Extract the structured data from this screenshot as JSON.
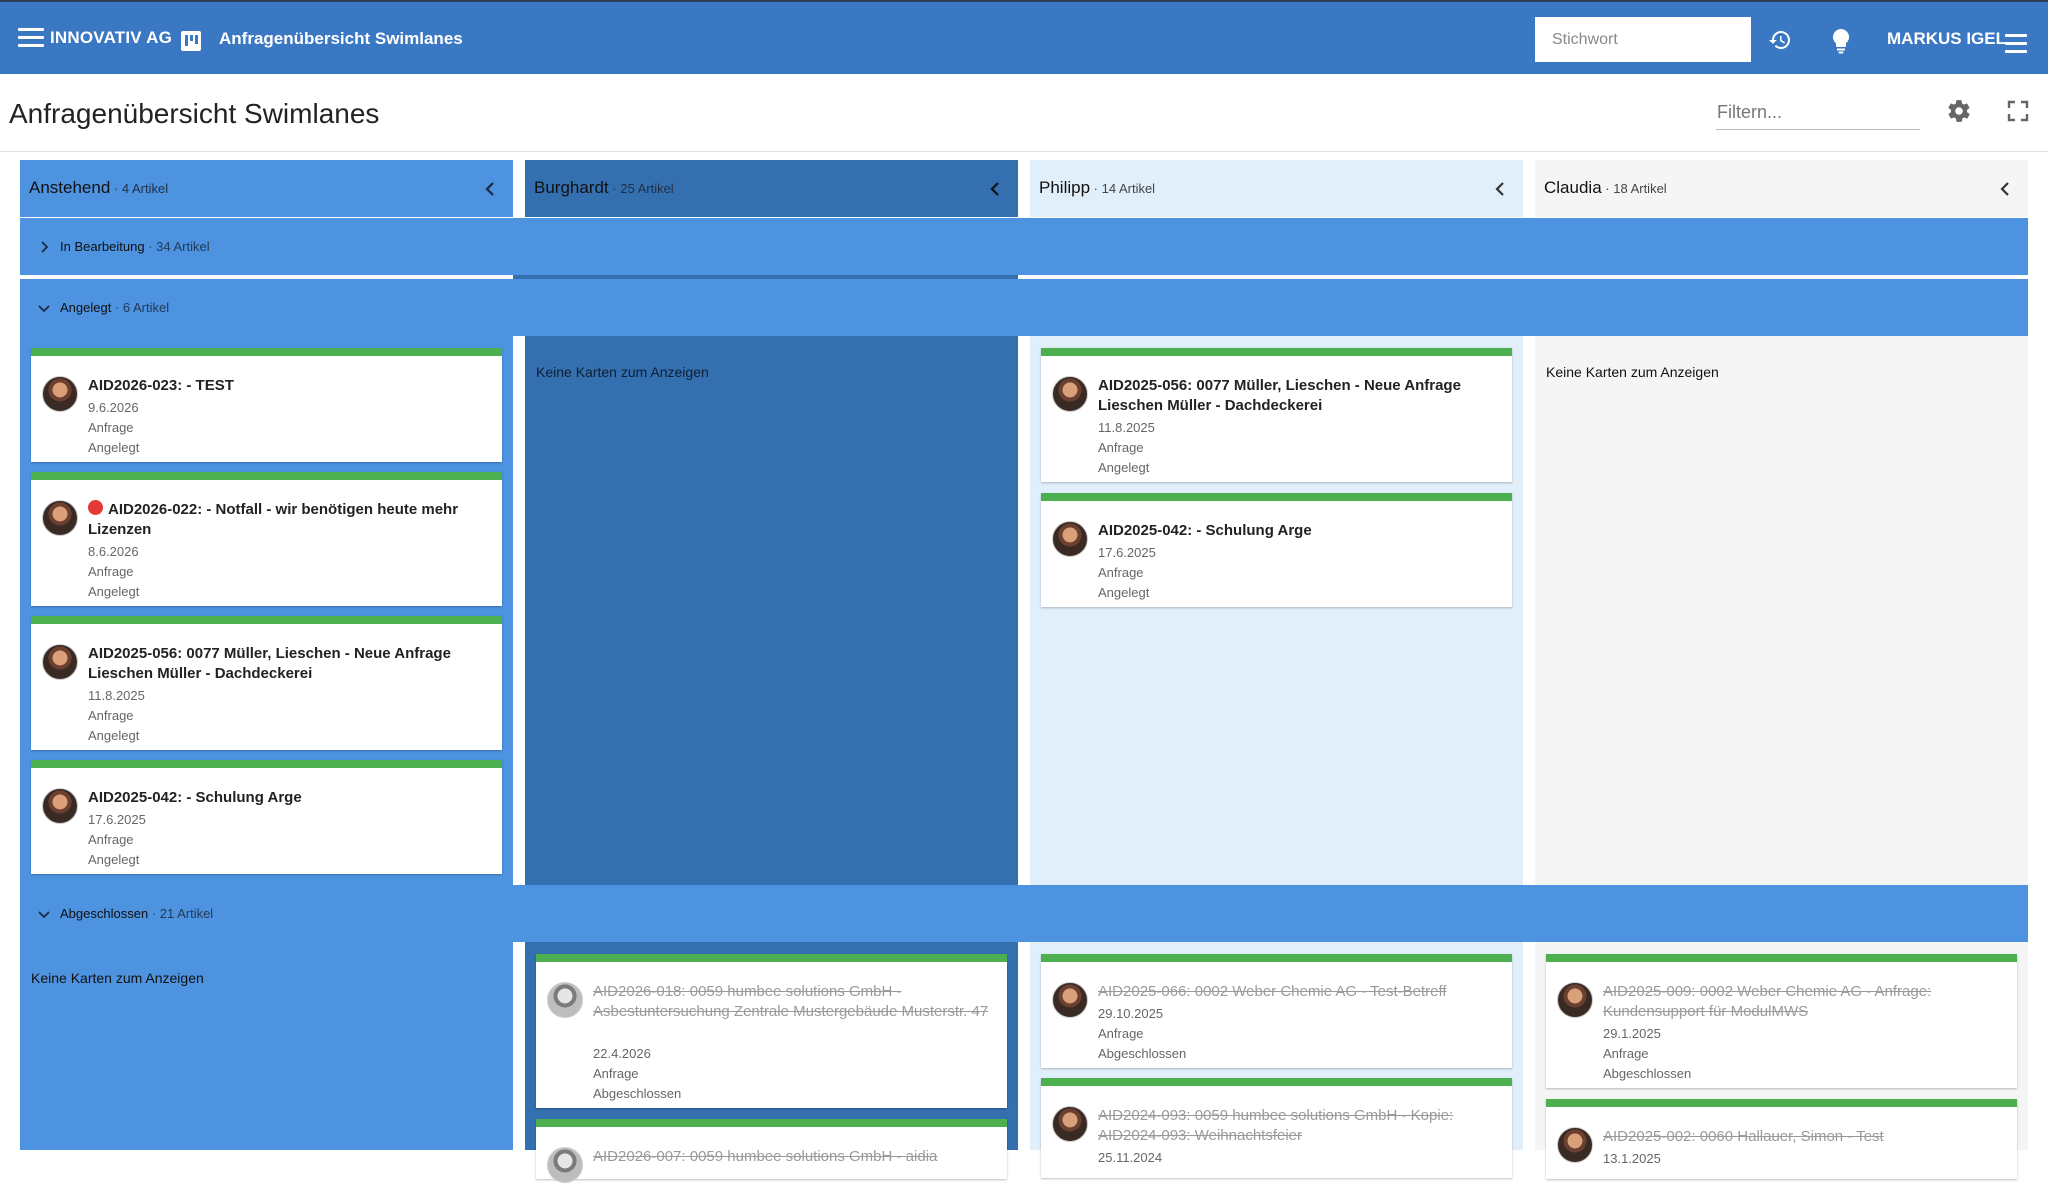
{
  "header": {
    "company": "INNOVATIV AG",
    "page_name": "Anfragenübersicht Swimlanes",
    "search_placeholder": "Stichwort",
    "user": "MARKUS IGEL"
  },
  "toolbar": {
    "title": "Anfragenübersicht Swimlanes",
    "filter_placeholder": "Filtern..."
  },
  "columns": [
    {
      "name": "Anstehend",
      "count": " · 4 Artikel"
    },
    {
      "name": "Burghardt",
      "count": " · 25 Artikel"
    },
    {
      "name": "Philipp",
      "count": " · 14 Artikel"
    },
    {
      "name": "Claudia",
      "count": " · 18 Artikel"
    }
  ],
  "groups": [
    {
      "label": "In Bearbeitung",
      "count": " · 34 Artikel",
      "expanded": false
    },
    {
      "label": "Angelegt",
      "count": " · 6 Artikel",
      "expanded": true
    },
    {
      "label": "Abgeschlossen",
      "count": " · 21 Artikel",
      "expanded": true
    }
  ],
  "empty_text": "Keine Karten zum Anzeigen",
  "angelegt": {
    "anstehend": [
      {
        "title": "AID2026-023: - TEST",
        "date": "9.6.2026",
        "type": "Anfrage",
        "status": "Angelegt"
      },
      {
        "title": "AID2026-022: - Notfall - wir benötigen heute mehr Lizenzen",
        "date": "8.6.2026",
        "type": "Anfrage",
        "status": "Angelegt"
      },
      {
        "title": "AID2025-056: 0077 Müller, Lieschen - Neue Anfrage Lieschen Müller - Dachdeckerei",
        "date": "11.8.2025",
        "type": "Anfrage",
        "status": "Angelegt"
      },
      {
        "title": "AID2025-042: - Schulung Arge",
        "date": "17.6.2025",
        "type": "Anfrage",
        "status": "Angelegt"
      }
    ],
    "philipp": [
      {
        "title": "AID2025-056: 0077 Müller, Lieschen - Neue Anfrage Lieschen Müller - Dachdeckerei",
        "date": "11.8.2025",
        "type": "Anfrage",
        "status": "Angelegt"
      },
      {
        "title": "AID2025-042: - Schulung Arge",
        "date": "17.6.2025",
        "type": "Anfrage",
        "status": "Angelegt"
      }
    ]
  },
  "abgeschlossen": {
    "burghardt": [
      {
        "title": "AID2026-018: 0059 humbee solutions GmbH - Asbestuntersuchung Zentrale Mustergebäude Musterstr. 47",
        "date": "22.4.2026",
        "type": "Anfrage",
        "status": "Abgeschlossen"
      },
      {
        "title": "AID2026-007: 0059 humbee solutions GmbH - aidia"
      }
    ],
    "philipp": [
      {
        "title": "AID2025-066: 0002 Weber Chemie AG - Test-Betreff",
        "date": "29.10.2025",
        "type": "Anfrage",
        "status": "Abgeschlossen"
      },
      {
        "title": "AID2024-093: 0059 humbee solutions GmbH - Kopie: AID2024-093: Weihnachtsfeier",
        "date": "25.11.2024"
      }
    ],
    "claudia": [
      {
        "title": "AID2025-009: 0002 Weber Chemie AG - Anfrage: Kundensupport für ModulMWS",
        "date": "29.1.2025",
        "type": "Anfrage",
        "status": "Abgeschlossen"
      },
      {
        "title": "AID2025-002: 0060 Hallauer, Simon - Test",
        "date": "13.1.2025"
      }
    ]
  },
  "colors": {
    "topbar": "#3a78c4",
    "lane_anstehend": "#4d93e0",
    "lane_burghardt": "#3470b0",
    "lane_philipp": "#e1effb",
    "lane_claudia": "#f5f5f5",
    "card_accent": "#4caf50",
    "alarm": "#e53935"
  },
  "icons": [
    "menu-icon",
    "board-icon",
    "history-icon",
    "lightbulb-icon",
    "user-menu-icon",
    "settings-icon",
    "fullscreen-icon",
    "chevron-left-icon",
    "chevron-right-icon",
    "chevron-down-icon",
    "alarm-dot-icon"
  ]
}
